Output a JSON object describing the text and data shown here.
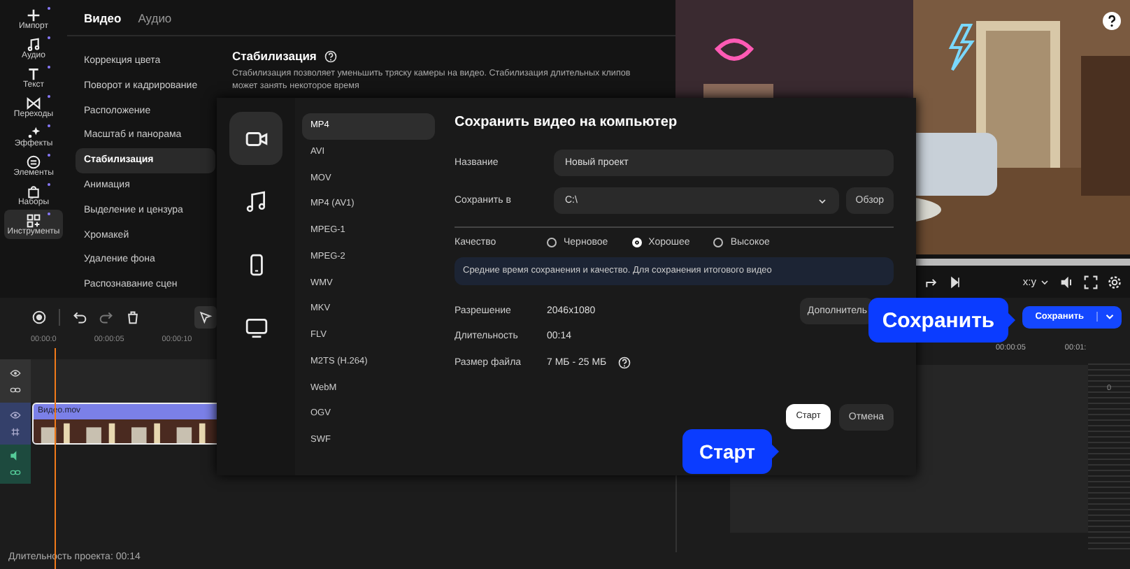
{
  "sidebar": {
    "items": [
      {
        "label": "Импорт",
        "selected": false
      },
      {
        "label": "Аудио",
        "selected": false
      },
      {
        "label": "Текст",
        "selected": false
      },
      {
        "label": "Переходы",
        "selected": false
      },
      {
        "label": "Эффекты",
        "selected": false
      },
      {
        "label": "Элементы",
        "selected": false
      },
      {
        "label": "Наборы",
        "selected": false
      },
      {
        "label": "Инструменты",
        "selected": true
      }
    ]
  },
  "panel": {
    "tabs": [
      {
        "label": "Видео",
        "selected": true
      },
      {
        "label": "Аудио",
        "selected": false
      }
    ],
    "menu": [
      {
        "label": "Коррекция цвета",
        "selected": false
      },
      {
        "label": "Поворот и кадрирование",
        "selected": false
      },
      {
        "label": "Расположение",
        "selected": false
      },
      {
        "label": "Масштаб и панорама",
        "selected": false
      },
      {
        "label": "Стабилизация",
        "selected": true
      },
      {
        "label": "Анимация",
        "selected": false
      },
      {
        "label": "Выделение и цензура",
        "selected": false
      },
      {
        "label": "Хромакей",
        "selected": false
      },
      {
        "label": "Удаление фона",
        "selected": false
      },
      {
        "label": "Распознавание сцен",
        "selected": false
      }
    ],
    "section": {
      "title": "Стабилизация",
      "description": "Стабилизация позволяет уменьшить тряску камеры на видео. Стабилизация длительных клипов может занять некоторое время"
    }
  },
  "preview": {
    "aspect": "x:y"
  },
  "export_button": "Сохранить",
  "timeline": {
    "ruler": [
      "00:00:0",
      "00:00:05",
      "00:00:10"
    ],
    "ruler_right": [
      "00:00:05",
      "00:01:"
    ],
    "clip": "Видео.mov",
    "meter_label": "0"
  },
  "status_bar": "Длительность проекта: 00:14",
  "dialog": {
    "categories": [
      {
        "selected": true
      },
      {
        "selected": false
      },
      {
        "selected": false
      },
      {
        "selected": false
      }
    ],
    "formats": [
      {
        "label": "MP4",
        "selected": true
      },
      {
        "label": "AVI",
        "selected": false
      },
      {
        "label": "MOV",
        "selected": false
      },
      {
        "label": "MP4 (AV1)",
        "selected": false
      },
      {
        "label": "MPEG-1",
        "selected": false
      },
      {
        "label": "MPEG-2",
        "selected": false
      },
      {
        "label": "WMV",
        "selected": false
      },
      {
        "label": "MKV",
        "selected": false
      },
      {
        "label": "FLV",
        "selected": false
      },
      {
        "label": "M2TS (H.264)",
        "selected": false
      },
      {
        "label": "WebM",
        "selected": false
      },
      {
        "label": "OGV",
        "selected": false
      },
      {
        "label": "SWF",
        "selected": false
      }
    ],
    "title": "Сохранить видео на компьютер",
    "name_label": "Название",
    "name_value": "Новый проект",
    "path_label": "Сохранить в",
    "path_value": "C:\\",
    "browse": "Обзор",
    "quality_label": "Качество",
    "quality": [
      {
        "label": "Черновое",
        "selected": false
      },
      {
        "label": "Хорошее",
        "selected": true
      },
      {
        "label": "Высокое",
        "selected": false
      }
    ],
    "hint": "Средние время сохранения и качество. Для сохранения итогового видео",
    "info": [
      {
        "label": "Разрешение",
        "value": "2046x1080",
        "help": false
      },
      {
        "label": "Длительность",
        "value": "00:14",
        "help": false
      },
      {
        "label": "Размер файла",
        "value": "7 МБ - 25 МБ",
        "help": true
      }
    ],
    "more": "Дополнитель",
    "start": "Старт",
    "cancel": "Отмена"
  },
  "callouts": [
    {
      "text": "Сохранить"
    },
    {
      "text": "Старт"
    }
  ]
}
